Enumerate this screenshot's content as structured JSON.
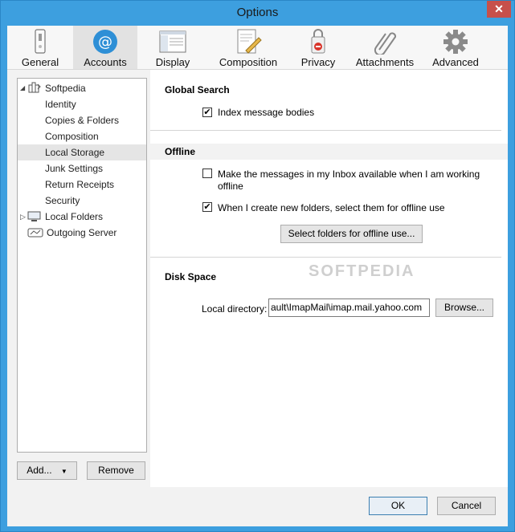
{
  "window": {
    "title": "Options",
    "close_glyph": "✕"
  },
  "toolbar": {
    "tabs": [
      {
        "label": "General",
        "icon": "switch-icon"
      },
      {
        "label": "Accounts",
        "icon": "at-sign-icon",
        "selected": true
      },
      {
        "label": "Display",
        "icon": "display-icon"
      },
      {
        "label": "Composition",
        "icon": "composition-icon"
      },
      {
        "label": "Privacy",
        "icon": "privacy-icon"
      },
      {
        "label": "Attachments",
        "icon": "paperclip-icon"
      },
      {
        "label": "Advanced",
        "icon": "gear-icon"
      }
    ]
  },
  "tree": {
    "items": [
      {
        "label": "Softpedia",
        "level": 0,
        "expanded": true
      },
      {
        "label": "Identity",
        "level": 1
      },
      {
        "label": "Copies & Folders",
        "level": 1
      },
      {
        "label": "Composition",
        "level": 1
      },
      {
        "label": "Local Storage",
        "level": 1,
        "selected": true
      },
      {
        "label": "Junk Settings",
        "level": 1
      },
      {
        "label": "Return Receipts",
        "level": 1
      },
      {
        "label": "Security",
        "level": 1
      },
      {
        "label": "Local Folders",
        "level": 0,
        "expanded": false
      },
      {
        "label": "Outgoing Server",
        "level": 0
      }
    ],
    "add_label": "Add...",
    "remove_label": "Remove"
  },
  "global_search": {
    "heading": "Global Search",
    "index_label": "Index message bodies",
    "index_checked": true
  },
  "offline": {
    "heading": "Offline",
    "inbox_label_line1": "Make the messages in my Inbox available when I am working",
    "inbox_label_line2": "offline",
    "inbox_checked": false,
    "folders_label": "When I create new folders, select them for offline use",
    "folders_checked": true,
    "select_button": "Select folders for offline use..."
  },
  "disk_space": {
    "heading": "Disk Space",
    "local_dir_label": "Local directory:",
    "local_dir_value": "ault\\ImapMail\\imap.mail.yahoo.com",
    "browse_label": "Browse..."
  },
  "footer": {
    "ok_label": "OK",
    "cancel_label": "Cancel"
  },
  "watermark": "SOFTPEDIA",
  "colors": {
    "title_bar": "#3d9fdf",
    "close": "#c7504b",
    "selected_tab": "#e2e2e2"
  }
}
